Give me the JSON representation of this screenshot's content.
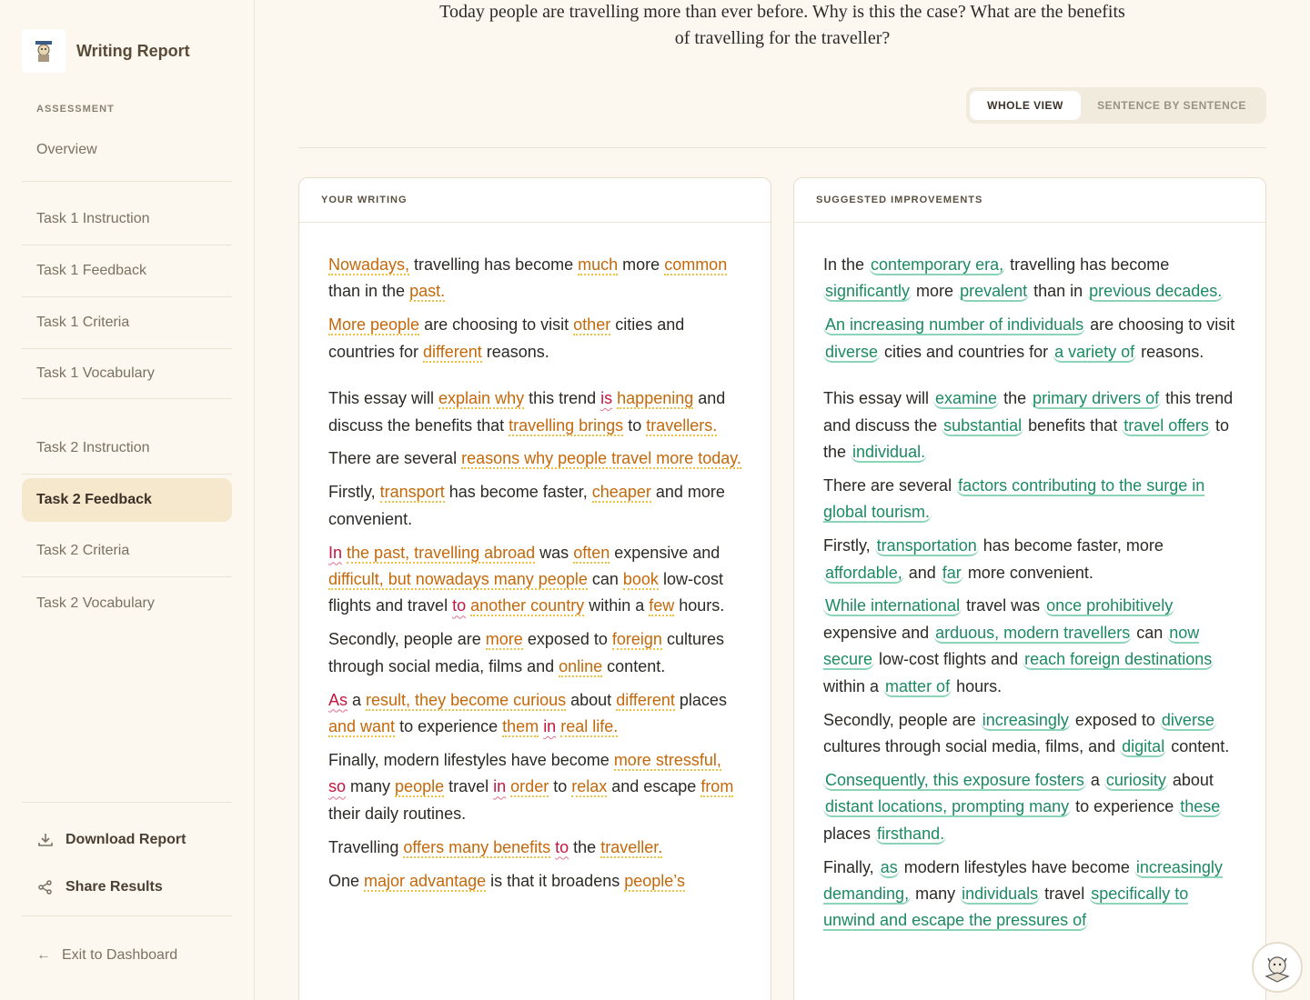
{
  "sidebar": {
    "title": "Writing Report",
    "section_label": "ASSESSMENT",
    "nav": [
      {
        "label": "Overview"
      },
      {
        "label": "Task 1 Instruction"
      },
      {
        "label": "Task 1 Feedback"
      },
      {
        "label": "Task 1 Criteria"
      },
      {
        "label": "Task 1 Vocabulary"
      },
      {
        "label": "Task 2 Instruction"
      },
      {
        "label": "Task 2 Feedback",
        "active": true
      },
      {
        "label": "Task 2 Criteria"
      },
      {
        "label": "Task 2 Vocabulary"
      }
    ],
    "actions": [
      {
        "label": "Download Report",
        "icon": "download-icon"
      },
      {
        "label": "Share Results",
        "icon": "share-icon"
      }
    ],
    "exit_label": "Exit to Dashboard"
  },
  "main": {
    "prompt": "Today people are travelling more than ever before. Why is this the case? What are the benefits of travelling for the traveller?",
    "view_toggle": {
      "whole": "WHOLE VIEW",
      "sentence": "SENTENCE BY SENTENCE",
      "selected": "WHOLE VIEW"
    },
    "left_panel": {
      "title": "YOUR WRITING",
      "paragraphs": [
        [
          {
            "t": "Nowadays,",
            "c": "o"
          },
          {
            "t": " travelling has become "
          },
          {
            "t": "much",
            "c": "o"
          },
          {
            "t": " more "
          },
          {
            "t": "common",
            "c": "o"
          },
          {
            "t": " than in the "
          },
          {
            "t": "past.",
            "c": "o"
          }
        ],
        [
          {
            "t": "More people",
            "c": "o"
          },
          {
            "t": " are choosing to visit "
          },
          {
            "t": "other",
            "c": "o"
          },
          {
            "t": " cities and countries for "
          },
          {
            "t": "different",
            "c": "o"
          },
          {
            "t": " reasons."
          }
        ],
        [
          {
            "t": "This essay will "
          },
          {
            "t": "explain why",
            "c": "o"
          },
          {
            "t": " this trend "
          },
          {
            "t": "is",
            "c": "r"
          },
          {
            "t": " "
          },
          {
            "t": "happening",
            "c": "o"
          },
          {
            "t": " and discuss the benefits that "
          },
          {
            "t": "travelling brings",
            "c": "o"
          },
          {
            "t": " to "
          },
          {
            "t": "travellers.",
            "c": "o"
          }
        ],
        [
          {
            "t": "There are several "
          },
          {
            "t": "reasons why people travel more today.",
            "c": "o"
          }
        ],
        [
          {
            "t": "Firstly, "
          },
          {
            "t": "transport",
            "c": "o"
          },
          {
            "t": " has become faster, "
          },
          {
            "t": "cheaper",
            "c": "o"
          },
          {
            "t": " and more convenient."
          }
        ],
        [
          {
            "t": "In",
            "c": "r"
          },
          {
            "t": " "
          },
          {
            "t": "the past, travelling abroad",
            "c": "o"
          },
          {
            "t": " was "
          },
          {
            "t": "often",
            "c": "o"
          },
          {
            "t": " expensive and "
          },
          {
            "t": "difficult, but nowadays many people",
            "c": "o"
          },
          {
            "t": " can "
          },
          {
            "t": "book",
            "c": "o"
          },
          {
            "t": " low-cost flights and travel "
          },
          {
            "t": "to",
            "c": "r"
          },
          {
            "t": " "
          },
          {
            "t": "another country",
            "c": "o"
          },
          {
            "t": " within a "
          },
          {
            "t": "few",
            "c": "o"
          },
          {
            "t": " hours."
          }
        ],
        [
          {
            "t": "Secondly, people are "
          },
          {
            "t": "more",
            "c": "o"
          },
          {
            "t": " exposed to "
          },
          {
            "t": "foreign",
            "c": "o"
          },
          {
            "t": " cultures through social media, films and "
          },
          {
            "t": "online",
            "c": "o"
          },
          {
            "t": " content."
          }
        ],
        [
          {
            "t": "As",
            "c": "r"
          },
          {
            "t": " a "
          },
          {
            "t": "result, they become curious",
            "c": "o"
          },
          {
            "t": " about "
          },
          {
            "t": "different",
            "c": "o"
          },
          {
            "t": " places "
          },
          {
            "t": "and want",
            "c": "o"
          },
          {
            "t": " to experience "
          },
          {
            "t": "them",
            "c": "o"
          },
          {
            "t": " "
          },
          {
            "t": "in",
            "c": "r"
          },
          {
            "t": " "
          },
          {
            "t": "real life.",
            "c": "o"
          }
        ],
        [
          {
            "t": "Finally, modern lifestyles have become "
          },
          {
            "t": "more stressful,",
            "c": "o"
          },
          {
            "t": " "
          },
          {
            "t": "so",
            "c": "r"
          },
          {
            "t": " many "
          },
          {
            "t": "people",
            "c": "o"
          },
          {
            "t": " travel "
          },
          {
            "t": "in",
            "c": "r"
          },
          {
            "t": " "
          },
          {
            "t": "order",
            "c": "o"
          },
          {
            "t": " to "
          },
          {
            "t": "relax",
            "c": "o"
          },
          {
            "t": " and escape "
          },
          {
            "t": "from",
            "c": "o"
          },
          {
            "t": " their daily routines."
          }
        ],
        [
          {
            "t": "Travelling "
          },
          {
            "t": "offers many benefits",
            "c": "o"
          },
          {
            "t": " "
          },
          {
            "t": "to",
            "c": "r"
          },
          {
            "t": " the "
          },
          {
            "t": "traveller.",
            "c": "o"
          }
        ],
        [
          {
            "t": "One "
          },
          {
            "t": "major advantage",
            "c": "o"
          },
          {
            "t": " is that it broadens "
          },
          {
            "t": "people’s",
            "c": "o"
          }
        ]
      ]
    },
    "right_panel": {
      "title": "SUGGESTED IMPROVEMENTS",
      "paragraphs": [
        [
          {
            "t": "In the "
          },
          {
            "t": "contemporary era,",
            "c": "g"
          },
          {
            "t": " travelling has become "
          },
          {
            "t": "significantly",
            "c": "g"
          },
          {
            "t": " more "
          },
          {
            "t": "prevalent",
            "c": "g"
          },
          {
            "t": " than in "
          },
          {
            "t": "previous decades.",
            "c": "g"
          }
        ],
        [
          {
            "t": "An increasing number of individuals",
            "c": "g"
          },
          {
            "t": " are choosing to visit "
          },
          {
            "t": "diverse",
            "c": "g"
          },
          {
            "t": " cities and countries for "
          },
          {
            "t": "a variety of",
            "c": "g"
          },
          {
            "t": " reasons."
          }
        ],
        [
          {
            "t": "This essay will "
          },
          {
            "t": "examine",
            "c": "g"
          },
          {
            "t": " the "
          },
          {
            "t": "primary drivers of",
            "c": "g"
          },
          {
            "t": " this trend and discuss the "
          },
          {
            "t": "substantial",
            "c": "g"
          },
          {
            "t": " benefits that "
          },
          {
            "t": "travel offers",
            "c": "g"
          },
          {
            "t": " to the "
          },
          {
            "t": "individual.",
            "c": "g"
          }
        ],
        [
          {
            "t": "There are several "
          },
          {
            "t": "factors contributing to the surge in global tourism.",
            "c": "g"
          }
        ],
        [
          {
            "t": "Firstly, "
          },
          {
            "t": "transportation",
            "c": "g"
          },
          {
            "t": " has become faster, more "
          },
          {
            "t": "affordable,",
            "c": "g"
          },
          {
            "t": " and "
          },
          {
            "t": "far",
            "c": "g"
          },
          {
            "t": " more convenient."
          }
        ],
        [
          {
            "t": "While international",
            "c": "g"
          },
          {
            "t": " travel was "
          },
          {
            "t": "once prohibitively",
            "c": "g"
          },
          {
            "t": " expensive and "
          },
          {
            "t": "arduous, modern travellers",
            "c": "g"
          },
          {
            "t": " can "
          },
          {
            "t": "now secure",
            "c": "g"
          },
          {
            "t": " low-cost flights and "
          },
          {
            "t": "reach foreign destinations",
            "c": "g"
          },
          {
            "t": " within a "
          },
          {
            "t": "matter of",
            "c": "g"
          },
          {
            "t": " hours."
          }
        ],
        [
          {
            "t": "Secondly, people are "
          },
          {
            "t": "increasingly",
            "c": "g"
          },
          {
            "t": " exposed to "
          },
          {
            "t": "diverse",
            "c": "g"
          },
          {
            "t": " cultures through social media, films, and "
          },
          {
            "t": "digital",
            "c": "g"
          },
          {
            "t": " content."
          }
        ],
        [
          {
            "t": "Consequently, this exposure fosters",
            "c": "g"
          },
          {
            "t": " a "
          },
          {
            "t": "curiosity",
            "c": "g"
          },
          {
            "t": " about "
          },
          {
            "t": "distant locations, prompting many",
            "c": "g"
          },
          {
            "t": " to experience "
          },
          {
            "t": "these",
            "c": "g"
          },
          {
            "t": " places "
          },
          {
            "t": "firsthand.",
            "c": "g"
          }
        ],
        [
          {
            "t": "Finally, "
          },
          {
            "t": "as",
            "c": "g"
          },
          {
            "t": " modern lifestyles have become "
          },
          {
            "t": "increasingly demanding,",
            "c": "g"
          },
          {
            "t": " many "
          },
          {
            "t": "individuals",
            "c": "g"
          },
          {
            "t": " travel "
          },
          {
            "t": "specifically to unwind and escape the pressures of",
            "c": "g"
          }
        ]
      ]
    }
  }
}
